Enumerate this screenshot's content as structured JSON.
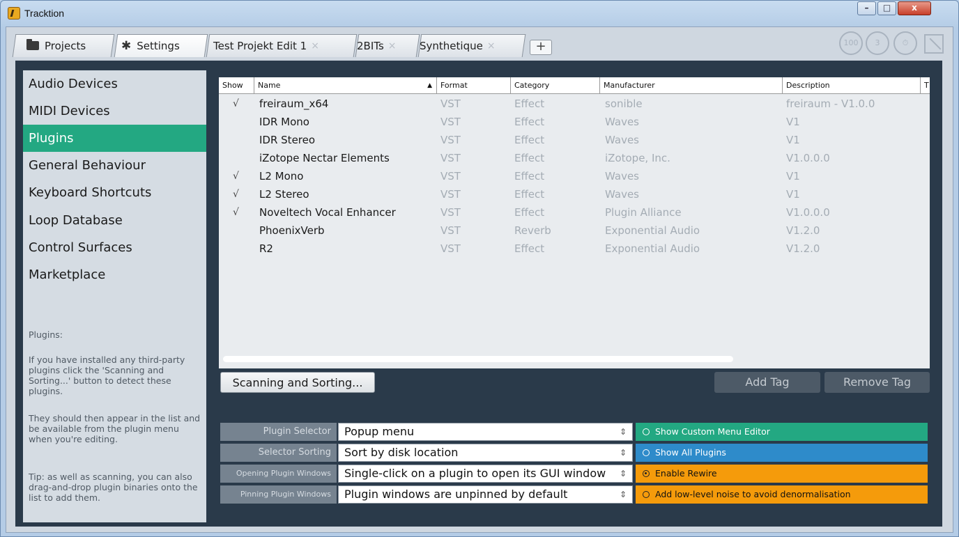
{
  "window": {
    "title": "Tracktion",
    "min_label": "–",
    "max_label": "□",
    "close_label": "x"
  },
  "tabs": [
    {
      "label": "Projects"
    },
    {
      "label": "Settings"
    },
    {
      "label": "Test Projekt Edit 1"
    },
    {
      "label": "2BITs"
    },
    {
      "label": "Synthetique"
    }
  ],
  "tab_close": "×",
  "add_tab": "+",
  "status_icons": [
    "100",
    "3"
  ],
  "sidebar": {
    "items": [
      {
        "label": "Audio Devices"
      },
      {
        "label": "MIDI Devices"
      },
      {
        "label": "Plugins"
      },
      {
        "label": "General Behaviour"
      },
      {
        "label": "Keyboard Shortcuts"
      },
      {
        "label": "Loop Database"
      },
      {
        "label": "Control Surfaces"
      },
      {
        "label": "Marketplace"
      }
    ],
    "active_index": 2,
    "help": [
      "Plugins:",
      "If you have installed any third-party plugins click the 'Scanning and Sorting...' button to detect these plugins.",
      "They should then appear in the list and be available from the plugin menu when you're editing.",
      "Tip: as well as scanning, you can also drag-and-drop plugin binaries onto the list to add them."
    ]
  },
  "table": {
    "columns": [
      "Show",
      "Name",
      "Format",
      "Category",
      "Manufacturer",
      "Description",
      "T"
    ],
    "sort_indicator": "▲",
    "check_mark": "√",
    "rows": [
      {
        "show": true,
        "name": "freiraum_x64",
        "format": "VST",
        "category": "Effect",
        "manufacturer": "sonible",
        "description": "freiraum - V1.0.0"
      },
      {
        "show": false,
        "name": "IDR Mono",
        "format": "VST",
        "category": "Effect",
        "manufacturer": "Waves",
        "description": "V1"
      },
      {
        "show": false,
        "name": "IDR Stereo",
        "format": "VST",
        "category": "Effect",
        "manufacturer": "Waves",
        "description": "V1"
      },
      {
        "show": false,
        "name": "iZotope Nectar Elements",
        "format": "VST",
        "category": "Effect",
        "manufacturer": "iZotope, Inc.",
        "description": "V1.0.0.0"
      },
      {
        "show": true,
        "name": "L2 Mono",
        "format": "VST",
        "category": "Effect",
        "manufacturer": "Waves",
        "description": "V1"
      },
      {
        "show": true,
        "name": "L2 Stereo",
        "format": "VST",
        "category": "Effect",
        "manufacturer": "Waves",
        "description": "V1"
      },
      {
        "show": true,
        "name": "Noveltech Vocal Enhancer",
        "format": "VST",
        "category": "Effect",
        "manufacturer": "Plugin Alliance",
        "description": "V1.0.0.0"
      },
      {
        "show": false,
        "name": "PhoenixVerb",
        "format": "VST",
        "category": "Reverb",
        "manufacturer": "Exponential Audio",
        "description": "V1.2.0"
      },
      {
        "show": false,
        "name": "R2",
        "format": "VST",
        "category": "Effect",
        "manufacturer": "Exponential Audio",
        "description": "V1.2.0"
      }
    ]
  },
  "buttons": {
    "scan": "Scanning and Sorting...",
    "add_tag": "Add Tag",
    "remove_tag": "Remove Tag"
  },
  "settings": [
    {
      "label": "Plugin Selector",
      "value": "Popup menu"
    },
    {
      "label": "Selector Sorting",
      "value": "Sort by disk location"
    },
    {
      "label": "Opening Plugin Windows",
      "value": "Single-click on a plugin to open its GUI window"
    },
    {
      "label": "Pinning Plugin Windows",
      "value": "Plugin windows are unpinned by default"
    }
  ],
  "select_arrow": "⇕",
  "options": [
    {
      "label": "Show Custom Menu Editor",
      "selected": false,
      "color": "#23a882"
    },
    {
      "label": "Show All Plugins",
      "selected": false,
      "color": "#2e8bca"
    },
    {
      "label": "Enable Rewire",
      "selected": true,
      "color": "#f59b0b"
    },
    {
      "label": "Add low-level noise to avoid denormalisation",
      "selected": false,
      "color": "#f59b0b"
    }
  ],
  "colors": {
    "accent": "#23a882",
    "panel": "#2a3a4a"
  }
}
